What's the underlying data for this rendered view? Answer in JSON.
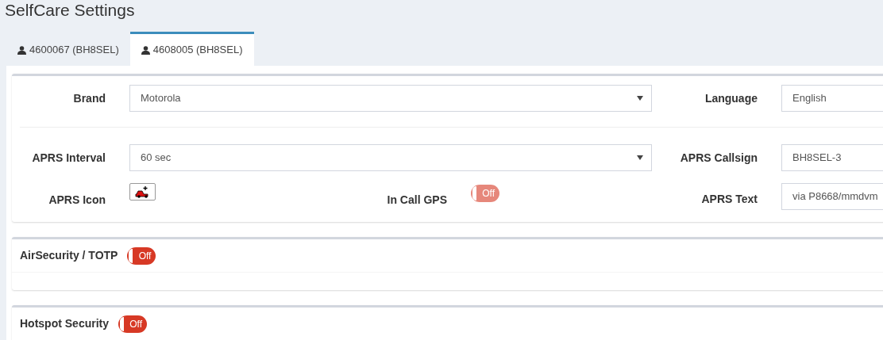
{
  "title": "SelfCare Settings",
  "tabs": [
    {
      "label": "4600067 (BH8SEL)",
      "selected": false
    },
    {
      "label": "4608005 (BH8SEL)",
      "selected": true
    }
  ],
  "settings": {
    "brand": {
      "label": "Brand",
      "value": "Motorola"
    },
    "language": {
      "label": "Language",
      "value": "English"
    },
    "aprs_interval": {
      "label": "APRS Interval",
      "value": "60 sec"
    },
    "aprs_callsign": {
      "label": "APRS Callsign",
      "value": "BH8SEL-3"
    },
    "aprs_icon": {
      "label": "APRS Icon"
    },
    "in_call_gps": {
      "label": "In Call GPS",
      "on": false,
      "disabled": true,
      "text": "Off"
    },
    "aprs_text": {
      "label": "APRS Text",
      "value": "via P8668/mmdvm"
    }
  },
  "sections": [
    {
      "title": "AirSecurity / TOTP",
      "toggle": {
        "on": false,
        "disabled": false,
        "text": "Off"
      }
    },
    {
      "title": "Hotspot Security",
      "toggle": {
        "on": false,
        "disabled": false,
        "text": "Off"
      }
    }
  ]
}
